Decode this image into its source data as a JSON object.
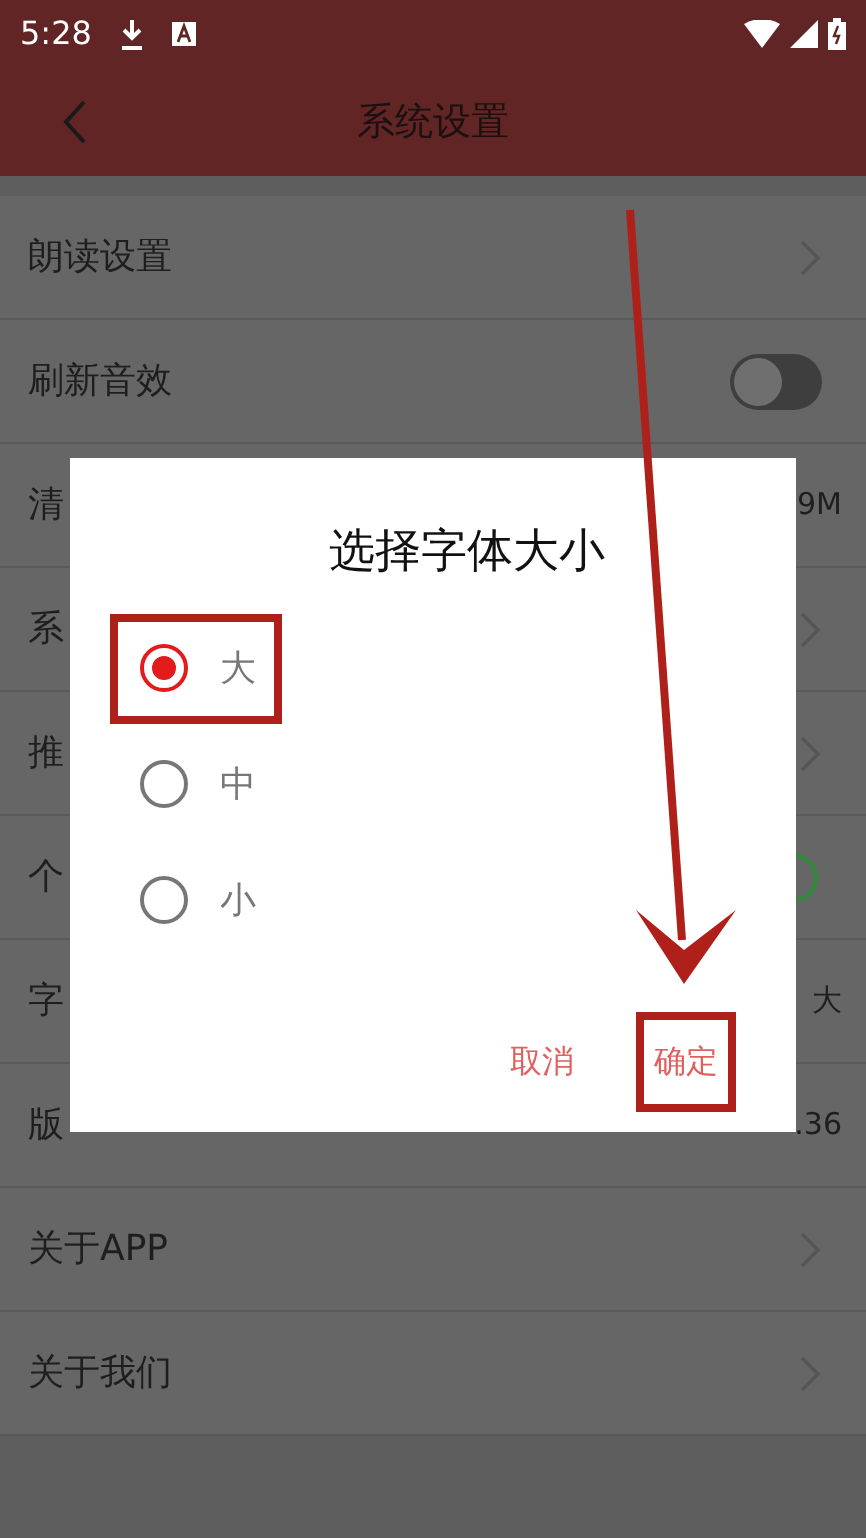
{
  "status_bar": {
    "time": "5:28"
  },
  "header": {
    "title": "系统设置"
  },
  "settings": [
    {
      "label": "朗读设置",
      "kind": "chevron"
    },
    {
      "label": "刷新音效",
      "kind": "toggle",
      "on": false
    },
    {
      "label": "清",
      "kind": "value",
      "value": "9M"
    },
    {
      "label": "系",
      "kind": "chevron"
    },
    {
      "label": "推",
      "kind": "chevron"
    },
    {
      "label": "个",
      "kind": "toggle",
      "on": true
    },
    {
      "label": "字",
      "kind": "value",
      "value": "大"
    },
    {
      "label": "版",
      "kind": "value",
      "value": ".36"
    },
    {
      "label": "关于APP",
      "kind": "chevron"
    },
    {
      "label": "关于我们",
      "kind": "chevron"
    }
  ],
  "dialog": {
    "title": "选择字体大小",
    "options": [
      {
        "label": "大",
        "selected": true
      },
      {
        "label": "中",
        "selected": false
      },
      {
        "label": "小",
        "selected": false
      }
    ],
    "buttons": [
      {
        "label": "取消",
        "highlighted": false
      },
      {
        "label": "确定",
        "highlighted": true
      }
    ]
  }
}
